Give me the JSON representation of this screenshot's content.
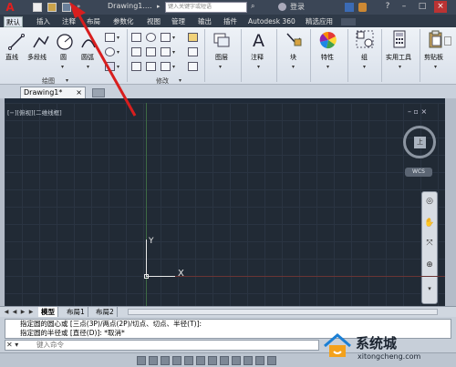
{
  "titlebar": {
    "logo": "A",
    "doc_title": "Drawing1....",
    "search_placeholder": "键入关键字或短语",
    "login": "登录",
    "controls": [
      "?",
      "–",
      "□",
      "×"
    ]
  },
  "menu": {
    "tabs": [
      "默认",
      "插入",
      "注释",
      "布局",
      "参数化",
      "视图",
      "管理",
      "输出",
      "插件",
      "Autodesk 360",
      "精选应用"
    ],
    "active_index": 0
  },
  "ribbon": {
    "draw_tools": [
      "直线",
      "多段线",
      "圆",
      "圆弧"
    ],
    "draw_panel": "绘图",
    "modify_panel": "修改",
    "layer": "图层",
    "annotate": "注释",
    "block": "块",
    "properties": "特性",
    "group": "组",
    "utilities": "实用工具",
    "clipboard": "剪贴板"
  },
  "doc_tab": {
    "label": "Drawing1*",
    "close": "×"
  },
  "viewport": {
    "label": "[−][俯视][二维线框]",
    "controls": "– ▫ ×",
    "viewcube_face": "上",
    "wcs": "WCS",
    "y_axis": "Y",
    "x_axis": "X"
  },
  "layout_tabs": {
    "nav": [
      "◀",
      "◀",
      "▶",
      "▶"
    ],
    "tabs": [
      "模型",
      "布局1",
      "布局2"
    ],
    "active_index": 0
  },
  "command": {
    "history": [
      "指定圆的圆心或 [三点(3P)/两点(2P)/切点、切点、半径(T)]:",
      "指定圆的半径或 [直径(D)]: *取消*"
    ],
    "input_placeholder": "键入命令",
    "icons": "✕ ▾"
  },
  "watermark": {
    "title": "系统城",
    "url": "xitongcheng.com"
  }
}
